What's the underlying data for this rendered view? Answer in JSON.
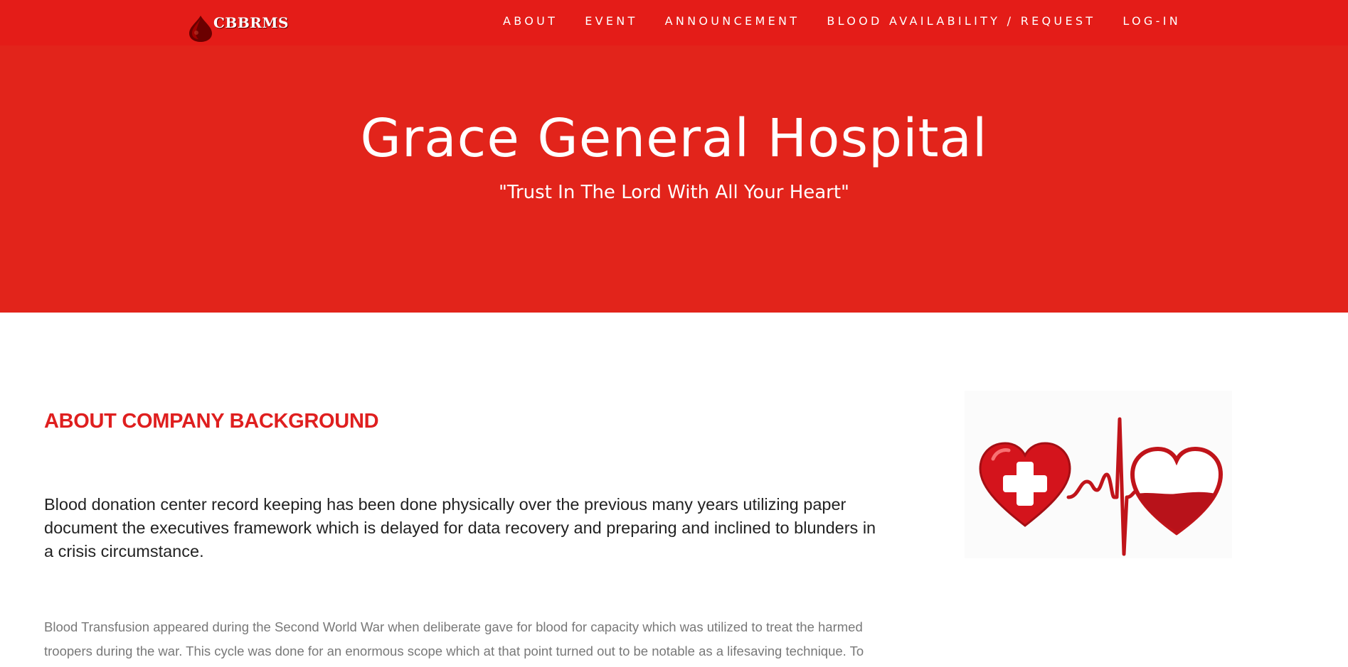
{
  "brand": {
    "name": "CBBRMS",
    "logo_icon": "blood-drop-logo-icon"
  },
  "nav": {
    "items": [
      {
        "label": "ABOUT"
      },
      {
        "label": "EVENT"
      },
      {
        "label": "ANNOUNCEMENT"
      },
      {
        "label": "BLOOD AVAILABILITY / REQUEST"
      },
      {
        "label": "LOG-IN"
      }
    ]
  },
  "hero": {
    "title": "Grace General Hospital",
    "subtitle": "\"Trust In The Lord With All Your Heart\""
  },
  "about": {
    "heading": "ABOUT COMPANY BACKGROUND",
    "lead": "Blood donation center record keeping has been done physically over the previous many years utilizing paper document the executives framework which is delayed for data recovery and preparing and inclined to blunders in a crisis circumstance.",
    "body": "Blood Transfusion appeared during the Second World War when deliberate gave for blood for capacity which was utilized to treat the harmed troopers during the war. This cycle was done for an enormous scope which at that point turned out to be notable as a lifesaving technique. To",
    "image_icon": "heart-heartbeat-blood-bag-icon"
  },
  "colors": {
    "nav_bg": "#e41c18",
    "hero_bg": "#e2241b",
    "accent": "#df1f1f",
    "text_dark": "#222222",
    "text_muted": "#787878"
  }
}
